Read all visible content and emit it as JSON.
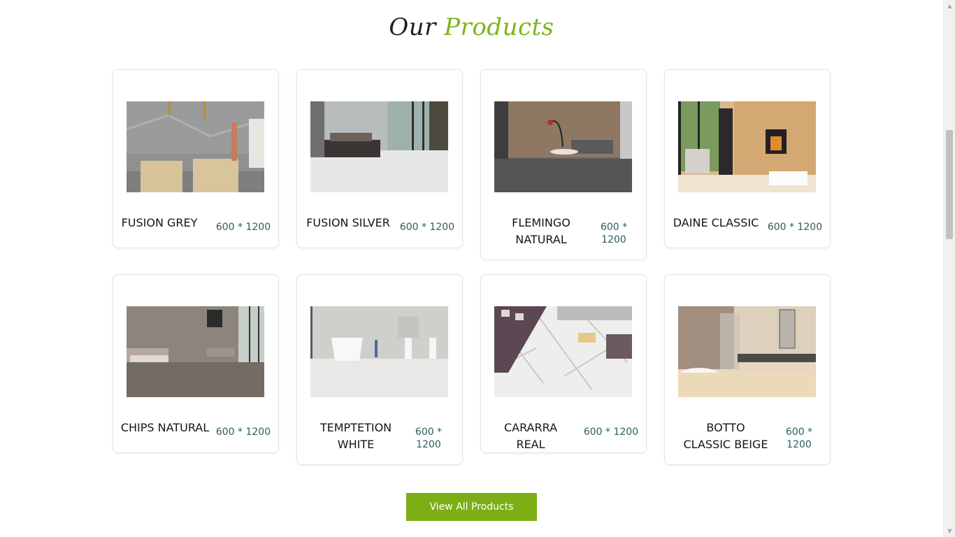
{
  "section": {
    "title_part1": "Our",
    "title_part2": "Products",
    "accent_color": "#7cb518"
  },
  "products": [
    {
      "name": "FUSION GREY",
      "size": "600 * 1200"
    },
    {
      "name": "FUSION SILVER",
      "size": "600 * 1200"
    },
    {
      "name": "FLEMINGO NATURAL",
      "size": "600 * 1200"
    },
    {
      "name": "DAINE CLASSIC",
      "size": "600 * 1200"
    },
    {
      "name": "CHIPS NATURAL",
      "size": "600 * 1200"
    },
    {
      "name": "TEMPTETION WHITE",
      "size": "600 * 1200"
    },
    {
      "name": "CARARRA REAL",
      "size": "600 * 1200"
    },
    {
      "name": "BOTTO CLASSIC BEIGE",
      "size": "600 * 1200"
    }
  ],
  "cta": {
    "label": "View All Products",
    "color": "#7cae16"
  }
}
